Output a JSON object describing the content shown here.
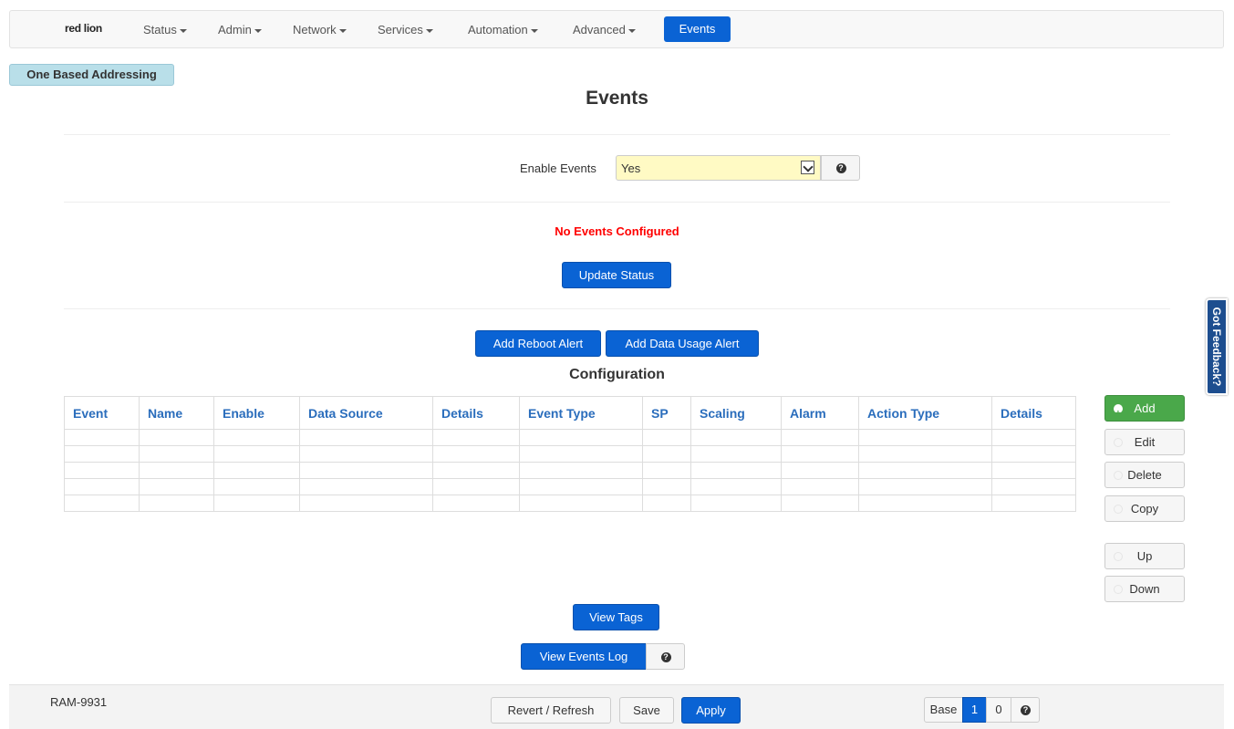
{
  "nav": {
    "logo": "red lion",
    "items": [
      "Status",
      "Admin",
      "Network",
      "Services",
      "Automation",
      "Advanced"
    ],
    "active": "Events"
  },
  "addressing_tag": "One Based Addressing",
  "page_title": "Events",
  "enable_events": {
    "label": "Enable Events",
    "value": "Yes"
  },
  "status_message": "No Events Configured",
  "buttons": {
    "update_status": "Update Status",
    "add_reboot_alert": "Add Reboot Alert",
    "add_data_usage_alert": "Add Data Usage Alert",
    "view_tags": "View Tags",
    "view_events_log": "View Events Log"
  },
  "configuration": {
    "title": "Configuration",
    "columns": [
      "Event",
      "Name",
      "Enable",
      "Data Source",
      "Details",
      "Event Type",
      "SP",
      "Scaling",
      "Alarm",
      "Action Type",
      "Details"
    ]
  },
  "side_actions": {
    "add": "Add",
    "edit": "Edit",
    "delete": "Delete",
    "copy": "Copy",
    "up": "Up",
    "down": "Down"
  },
  "feedback": "Got Feedback?",
  "footer": {
    "model": "RAM-9931",
    "revert": "Revert / Refresh",
    "save": "Save",
    "apply": "Apply",
    "base_label": "Base",
    "base_options": [
      "1",
      "0"
    ],
    "base_selected": "1"
  },
  "colors": {
    "primary": "#0a63d4",
    "success": "#4aa84a",
    "error": "#ff0000",
    "highlight": "#fffac4",
    "tag": "#b9dfe9"
  }
}
